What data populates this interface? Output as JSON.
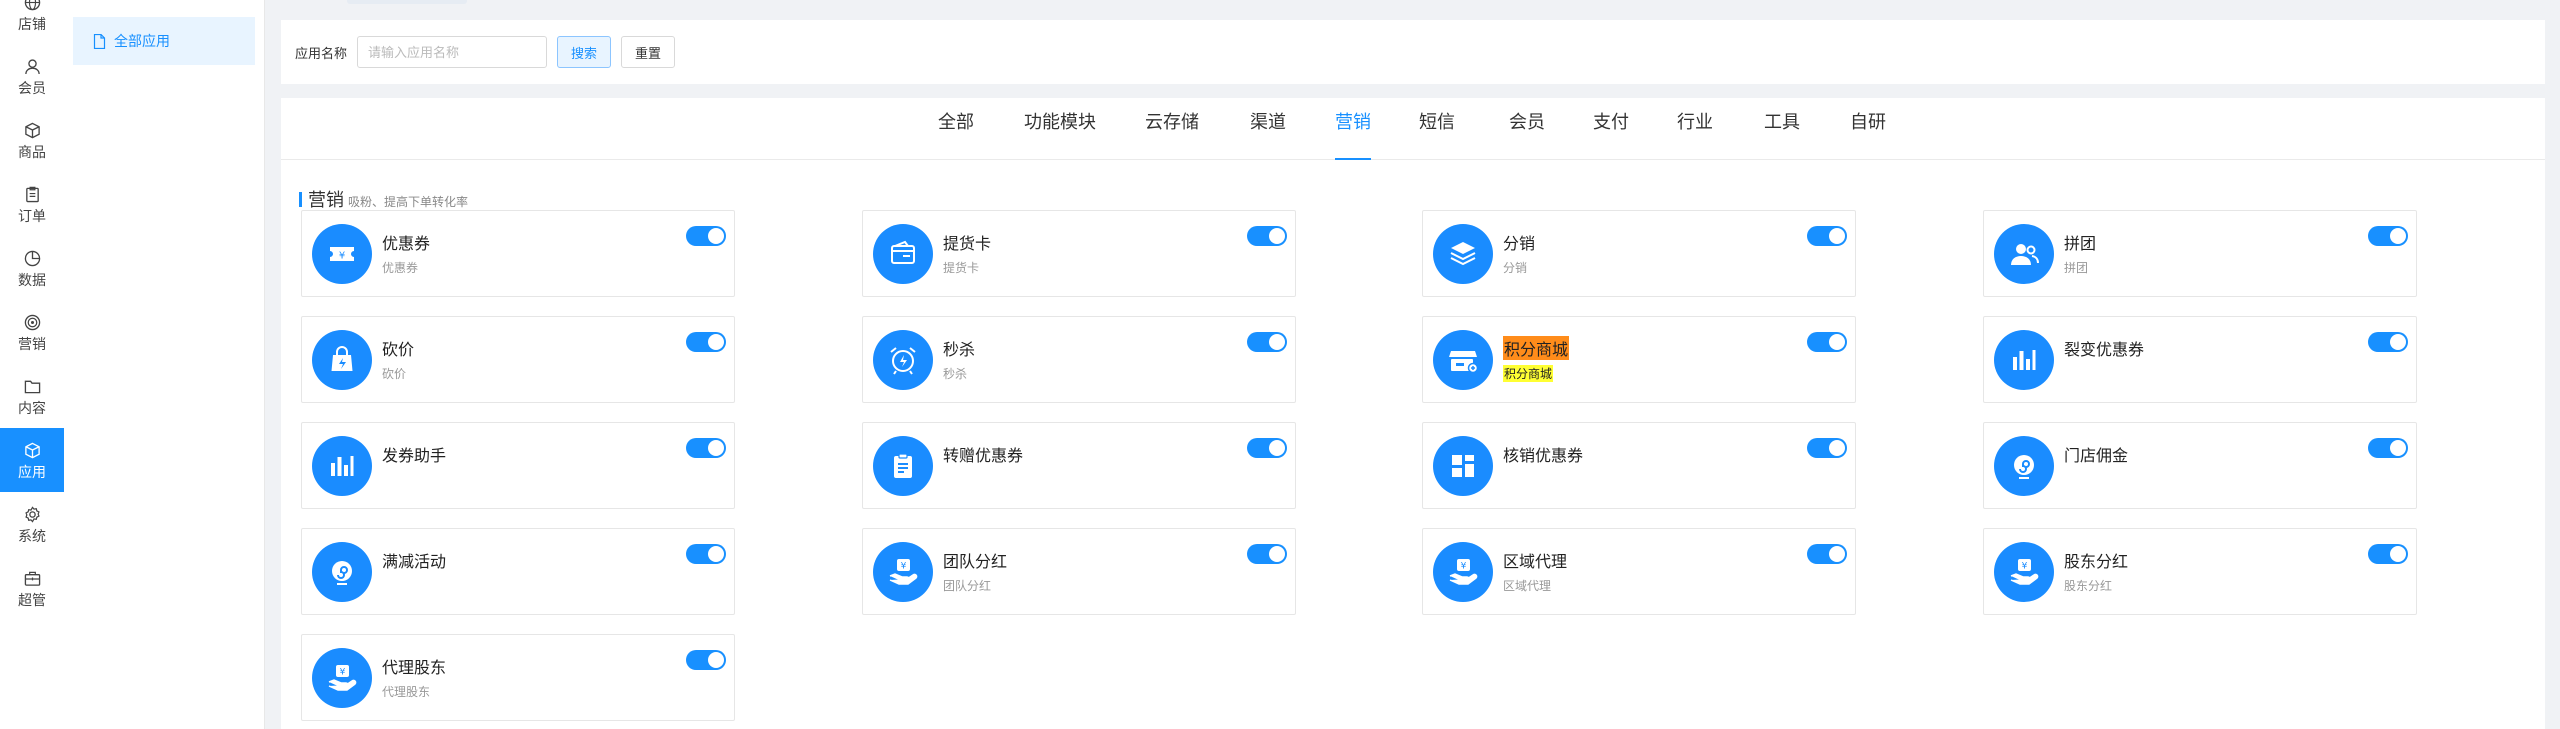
{
  "rail": {
    "items": [
      {
        "label": "店铺",
        "icon": "globe-icon"
      },
      {
        "label": "会员",
        "icon": "user-icon"
      },
      {
        "label": "商品",
        "icon": "box-icon"
      },
      {
        "label": "订单",
        "icon": "clipboard-icon"
      },
      {
        "label": "数据",
        "icon": "pie-chart-icon"
      },
      {
        "label": "营销",
        "icon": "target-icon"
      },
      {
        "label": "内容",
        "icon": "folder-icon"
      },
      {
        "label": "应用",
        "icon": "cube-icon"
      },
      {
        "label": "系统",
        "icon": "gear-icon"
      },
      {
        "label": "超管",
        "icon": "briefcase-icon"
      }
    ],
    "active_label": "应用"
  },
  "subnav": {
    "item_label": "全部应用",
    "icon": "file-icon"
  },
  "search": {
    "label": "应用名称",
    "placeholder": "请输入应用名称",
    "value": "",
    "search_button": "搜索",
    "reset_button": "重置"
  },
  "tabs": [
    "全部",
    "功能模块",
    "云存储",
    "渠道",
    "营销",
    "短信",
    "会员",
    "支付",
    "行业",
    "工具",
    "自研"
  ],
  "active_tab": "营销",
  "section": {
    "title": "营销",
    "subtitle": "吸粉、提高下单转化率"
  },
  "accent_color": "#1890ff",
  "apps": [
    {
      "name": "优惠券",
      "desc": "优惠券",
      "icon": "coupon-icon",
      "enabled": true
    },
    {
      "name": "提货卡",
      "desc": "提货卡",
      "icon": "wallet-card-icon",
      "enabled": true
    },
    {
      "name": "分销",
      "desc": "分销",
      "icon": "layers-icon",
      "enabled": true
    },
    {
      "name": "拼团",
      "desc": "拼团",
      "icon": "users-icon",
      "enabled": true
    },
    {
      "name": "砍价",
      "desc": "砍价",
      "icon": "shopping-bag-icon",
      "enabled": true
    },
    {
      "name": "秒杀",
      "desc": "秒杀",
      "icon": "alarm-clock-icon",
      "enabled": true
    },
    {
      "name": "积分商城",
      "desc": "积分商城",
      "icon": "store-icon",
      "enabled": true,
      "highlighted": true
    },
    {
      "name": "裂变优惠券",
      "desc": "",
      "icon": "bar-chart-icon",
      "enabled": true
    },
    {
      "name": "发券助手",
      "desc": "",
      "icon": "bar-chart-icon",
      "enabled": true
    },
    {
      "name": "转赠优惠券",
      "desc": "",
      "icon": "clipboard-list-icon",
      "enabled": true
    },
    {
      "name": "核销优惠券",
      "desc": "",
      "icon": "grid-icon",
      "enabled": true
    },
    {
      "name": "门店佣金",
      "desc": "",
      "icon": "mini-program-icon",
      "enabled": true
    },
    {
      "name": "满减活动",
      "desc": "",
      "icon": "mini-program-icon",
      "enabled": true
    },
    {
      "name": "团队分红",
      "desc": "团队分红",
      "icon": "hand-yen-icon",
      "enabled": true
    },
    {
      "name": "区域代理",
      "desc": "区域代理",
      "icon": "hand-yen-icon",
      "enabled": true
    },
    {
      "name": "股东分红",
      "desc": "股东分红",
      "icon": "hand-yen-icon",
      "enabled": true
    },
    {
      "name": "代理股东",
      "desc": "代理股东",
      "icon": "hand-yen-icon",
      "enabled": true
    }
  ]
}
